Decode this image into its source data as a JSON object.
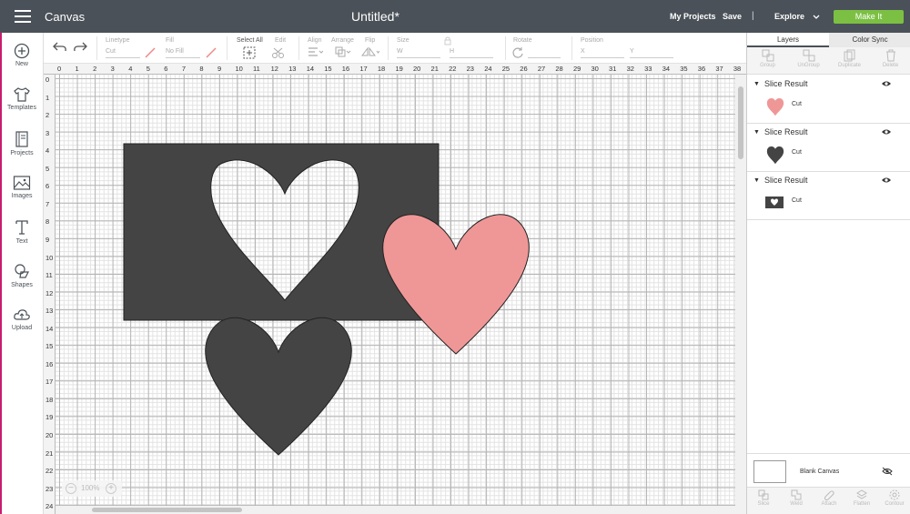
{
  "header": {
    "app_title": "Canvas",
    "doc_title": "Untitled*",
    "my_projects": "My Projects",
    "save": "Save",
    "separator": "|",
    "explore": "Explore",
    "make_it": "Make It",
    "make_it_color": "#7cc043",
    "bar_color": "#4a5158"
  },
  "sidebar": {
    "accent_color": "#c81c6e",
    "items": [
      {
        "label": "New",
        "icon": "plus-circle-icon"
      },
      {
        "label": "Templates",
        "icon": "tshirt-icon"
      },
      {
        "label": "Projects",
        "icon": "book-icon"
      },
      {
        "label": "Images",
        "icon": "image-icon"
      },
      {
        "label": "Text",
        "icon": "text-t-icon"
      },
      {
        "label": "Shapes",
        "icon": "shapes-icon"
      },
      {
        "label": "Upload",
        "icon": "cloud-upload-icon"
      }
    ]
  },
  "toolbar": {
    "linetype_label": "Linetype",
    "linetype_value": "Cut",
    "fill_label": "Fill",
    "fill_value": "No Fill",
    "select_all": "Select All",
    "edit": "Edit",
    "align": "Align",
    "arrange": "Arrange",
    "flip": "Flip",
    "size": "Size",
    "size_w": "W",
    "size_h": "H",
    "rotate": "Rotate",
    "position": "Position",
    "pos_x": "X",
    "pos_y": "Y"
  },
  "ruler": {
    "top": [
      "0",
      "1",
      "2",
      "3",
      "4",
      "5",
      "6",
      "7",
      "8",
      "9",
      "10",
      "11",
      "12",
      "13",
      "14",
      "15",
      "16",
      "17",
      "18",
      "19",
      "20",
      "21",
      "22",
      "23",
      "24",
      "25",
      "26",
      "27",
      "28",
      "29",
      "30",
      "31",
      "32",
      "33",
      "34",
      "35",
      "36",
      "37",
      "38"
    ],
    "left": [
      "0",
      "1",
      "2",
      "3",
      "4",
      "5",
      "6",
      "7",
      "8",
      "9",
      "10",
      "11",
      "12",
      "13",
      "14",
      "15",
      "16",
      "17",
      "18",
      "19",
      "20",
      "21",
      "22",
      "23",
      "24"
    ]
  },
  "canvas": {
    "zoom_value": "100%",
    "zoom_minus": "−",
    "zoom_plus": "+",
    "shape_dark_color": "#444444",
    "shape_pink_color": "#ef9797"
  },
  "layers_panel": {
    "tabs": [
      "Layers",
      "Color Sync"
    ],
    "tools": [
      "Group",
      "UnGroup",
      "Duplicate",
      "Delete"
    ],
    "layers": [
      {
        "name": "Slice Result",
        "operation": "Cut",
        "thumb_color": "#ef9797",
        "thumb": "pink-heart"
      },
      {
        "name": "Slice Result",
        "operation": "Cut",
        "thumb_color": "#444444",
        "thumb": "dark-heart"
      },
      {
        "name": "Slice Result",
        "operation": "Cut",
        "thumb_color": "#444444",
        "thumb": "rectangle-heart-cutout"
      }
    ],
    "blank_canvas": "Blank Canvas",
    "bottom_tools": [
      "Slice",
      "Weld",
      "Attach",
      "Flatten",
      "Contour"
    ]
  }
}
